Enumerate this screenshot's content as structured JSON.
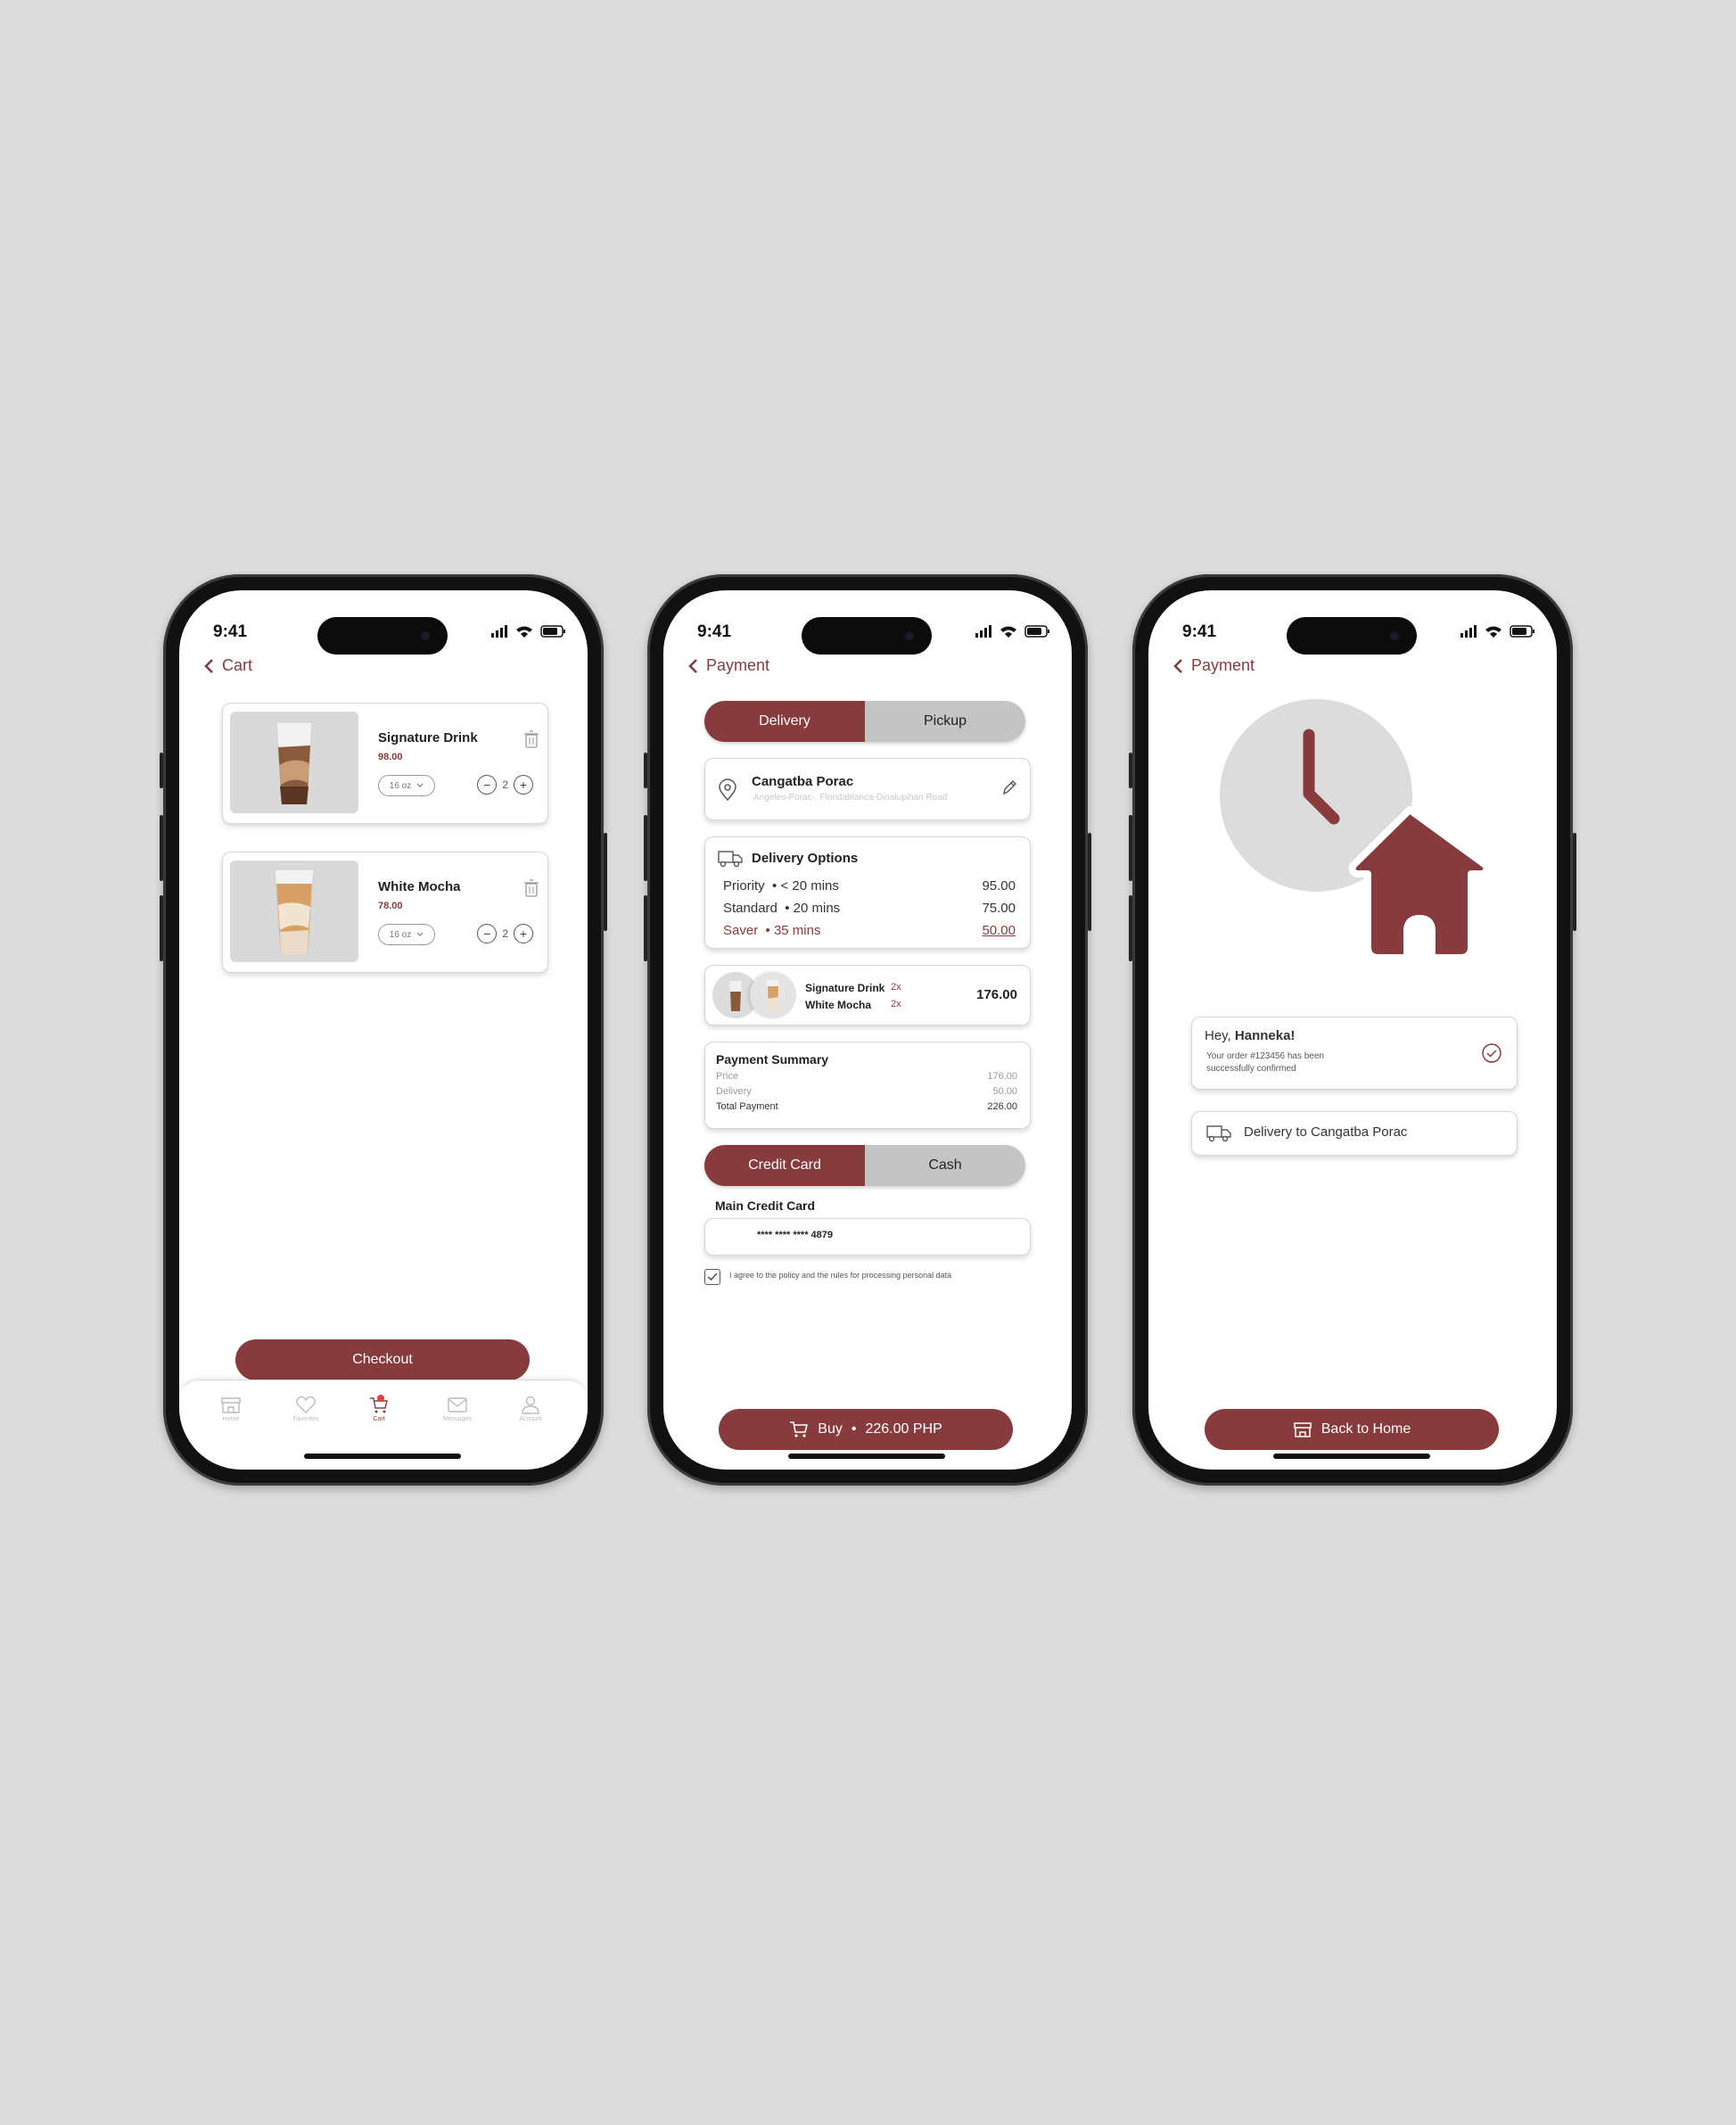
{
  "status": {
    "time": "9:41"
  },
  "cart": {
    "back_label": "Cart",
    "items": [
      {
        "name": "Signature Drink",
        "price": "98.00",
        "size": "16 oz",
        "qty": "2"
      },
      {
        "name": "White Mocha",
        "price": "78.00",
        "size": "16 oz",
        "qty": "2"
      }
    ],
    "checkout_label": "Checkout",
    "tabs": [
      "Home",
      "Favorites",
      "Cart",
      "Messages",
      "Account"
    ]
  },
  "payment": {
    "back_label": "Payment",
    "mode_tabs": [
      "Delivery",
      "Pickup"
    ],
    "address": {
      "name": "Cangatba Porac",
      "line": "Angeles-Porac-, Floridablanca-Dinalupihan Road"
    },
    "delivery_options": {
      "title": "Delivery Options",
      "options": [
        {
          "label": "Priority",
          "time": "< 20 mins",
          "price": "95.00"
        },
        {
          "label": "Standard",
          "time": "20 mins",
          "price": "75.00"
        },
        {
          "label": "Saver",
          "time": "35 mins",
          "price": "50.00"
        }
      ]
    },
    "order": {
      "items": [
        {
          "name": "Signature Drink",
          "qty": "2x"
        },
        {
          "name": "White Mocha",
          "qty": "2x"
        }
      ],
      "total": "176.00"
    },
    "summary": {
      "title": "Payment Summary",
      "rows": [
        {
          "label": "Price",
          "value": "176.00"
        },
        {
          "label": "Delivery",
          "value": "50.00"
        },
        {
          "label": "Total Payment",
          "value": "226.00"
        }
      ]
    },
    "method_tabs": [
      "Credit Card",
      "Cash"
    ],
    "card_label": "Main Credit Card",
    "card_number": "**** **** **** 4879",
    "agree_text": "I agree to the policy and the rules for processing personal data",
    "buy_label": "Buy",
    "buy_amount": "226.00 PHP"
  },
  "confirm": {
    "back_label": "Payment",
    "greeting_prefix": "Hey, ",
    "greeting_name": "Hanneka!",
    "message_line1": "Your order #123456 has been",
    "message_line2": "successfully confirmed",
    "delivery_label": "Delivery to Cangatba Porac",
    "home_label": "Back to Home"
  },
  "colors": {
    "accent": "#873b3c",
    "muted": "#c4c4c4",
    "background": "#dcdcdc"
  }
}
